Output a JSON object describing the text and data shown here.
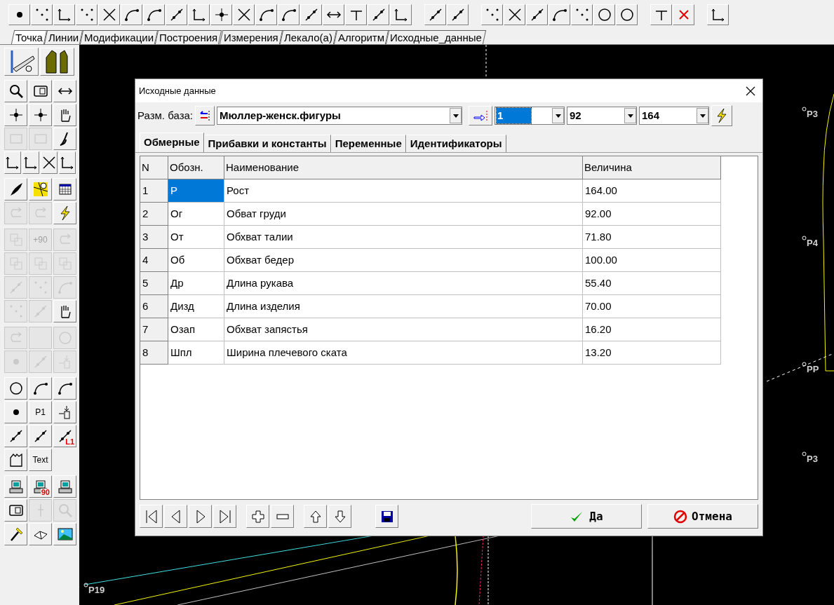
{
  "tabs": [
    {
      "label": "Точка",
      "selected": true
    },
    {
      "label": "Линии",
      "selected": false
    },
    {
      "label": "Модификации",
      "selected": false
    },
    {
      "label": "Построения",
      "selected": false
    },
    {
      "label": "Измерения",
      "selected": false
    },
    {
      "label": "Лекало(а)",
      "selected": false
    },
    {
      "label": "Алгоритм",
      "selected": false
    },
    {
      "label": "Исходные_данные",
      "selected": false
    }
  ],
  "left_toolbar": [
    [
      {
        "disabled": false
      },
      {
        "disabled": false
      }
    ],
    [
      {
        "disabled": false
      },
      {
        "disabled": false
      },
      {
        "disabled": false
      }
    ],
    [
      {
        "disabled": false
      },
      {
        "disabled": false
      },
      {
        "disabled": false
      }
    ],
    [
      {
        "disabled": true
      },
      {
        "disabled": true
      },
      {
        "disabled": false
      }
    ],
    [
      {
        "disabled": false
      },
      {
        "disabled": false
      },
      {
        "disabled": false
      },
      {
        "disabled": false
      }
    ],
    [
      {
        "disabled": false
      },
      {
        "disabled": false
      },
      {
        "disabled": false
      }
    ],
    [
      {
        "disabled": true
      },
      {
        "disabled": true
      },
      {
        "disabled": false
      }
    ],
    [
      {
        "disabled": true
      },
      {
        "disabled": true,
        "label": "+90"
      },
      {
        "disabled": true
      }
    ],
    [
      {
        "disabled": true
      },
      {
        "disabled": true
      },
      {
        "disabled": true
      }
    ],
    [
      {
        "disabled": true
      },
      {
        "disabled": true
      },
      {
        "disabled": true
      }
    ],
    [
      {
        "disabled": true
      },
      {
        "disabled": true
      },
      {
        "disabled": false
      }
    ],
    [
      {
        "disabled": true
      },
      {
        "disabled": true
      },
      {
        "disabled": true
      }
    ],
    [
      {
        "disabled": true
      },
      {
        "disabled": true
      },
      {
        "disabled": true
      }
    ],
    [
      {
        "disabled": false
      },
      {
        "disabled": false
      },
      {
        "disabled": false
      }
    ],
    [
      {
        "disabled": false
      },
      {
        "disabled": false,
        "label": "P1"
      },
      {
        "disabled": false
      }
    ],
    [
      {
        "disabled": false
      },
      {
        "disabled": false
      },
      {
        "disabled": false,
        "label": "L1"
      }
    ],
    [
      {
        "disabled": false
      },
      {
        "disabled": false,
        "label": "Text"
      }
    ],
    [
      {
        "disabled": false
      },
      {
        "disabled": false,
        "label": "90"
      },
      {
        "disabled": false
      }
    ],
    [
      {
        "disabled": false
      },
      {
        "disabled": true
      },
      {
        "disabled": true
      }
    ],
    [
      {
        "disabled": false
      },
      {
        "disabled": false
      },
      {
        "disabled": false
      }
    ]
  ],
  "canvas_points": [
    {
      "label": "P3"
    },
    {
      "label": "P4"
    },
    {
      "label": "PP"
    },
    {
      "label": "P3"
    },
    {
      "label": "P19"
    }
  ],
  "dialog": {
    "title": "Исходные данные",
    "base_label": "Разм. база:",
    "base_value": "Мюллер-женск.фигуры",
    "size_combos": [
      {
        "value": "1",
        "selected": true
      },
      {
        "value": "92",
        "selected": false
      },
      {
        "value": "164",
        "selected": false
      }
    ],
    "tabs": [
      {
        "label": "Обмерные",
        "selected": true
      },
      {
        "label": "Прибавки и константы",
        "selected": false
      },
      {
        "label": "Переменные",
        "selected": false
      },
      {
        "label": "Идентификаторы",
        "selected": false
      }
    ],
    "table": {
      "columns": [
        "N",
        "Обозн.",
        "Наименование",
        "Величина"
      ],
      "rows": [
        {
          "cells": [
            "1",
            "Р",
            "Рост",
            "164.00"
          ],
          "selected": true
        },
        {
          "cells": [
            "2",
            "Ог",
            "Обват груди",
            "92.00"
          ],
          "selected": false
        },
        {
          "cells": [
            "3",
            "От",
            "Обхват талии",
            "71.80"
          ],
          "selected": false
        },
        {
          "cells": [
            "4",
            "Об",
            "Обхват бедер",
            "100.00"
          ],
          "selected": false
        },
        {
          "cells": [
            "5",
            "Др",
            "Длина рукава",
            "55.40"
          ],
          "selected": false
        },
        {
          "cells": [
            "6",
            "Дизд",
            "Длина изделия",
            "70.00"
          ],
          "selected": false
        },
        {
          "cells": [
            "7",
            "Озап",
            "Обхват запястья",
            "16.20"
          ],
          "selected": false
        },
        {
          "cells": [
            "8",
            "Шпл",
            "Ширина плечевого ската",
            "13.20"
          ],
          "selected": false
        }
      ]
    },
    "ok_label": "Да",
    "cancel_label": "Отмена"
  }
}
